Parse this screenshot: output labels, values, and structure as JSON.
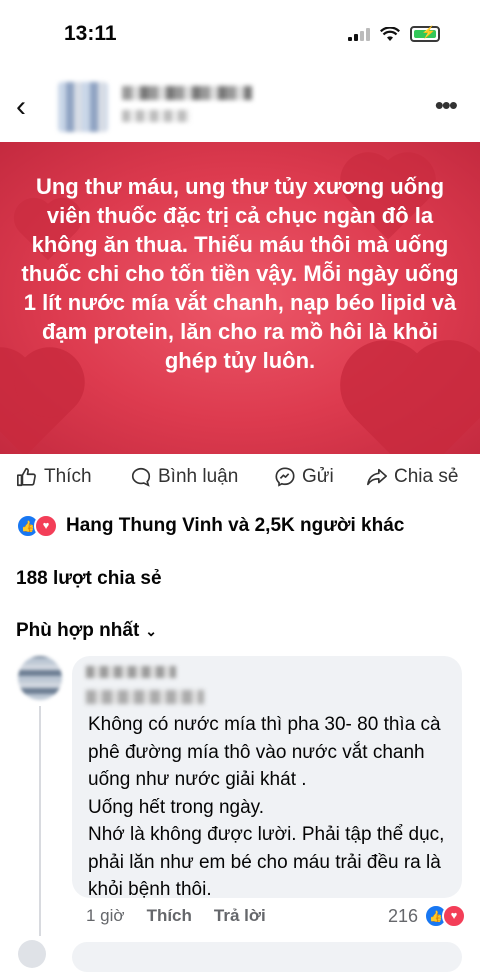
{
  "status_bar": {
    "time": "13:11"
  },
  "post": {
    "text": "Ung thư máu, ung thư tủy xương uống viên thuốc đặc trị cả chục ngàn đô la không ăn thua. Thiếu máu thôi mà uống thuốc chi cho tốn tiền vậy. Mỗi ngày uống 1 lít nước mía vắt chanh, nạp béo lipid và đạm protein, lăn cho ra mồ hôi là khỏi ghép tủy luôn."
  },
  "actions": {
    "like": "Thích",
    "comment": "Bình luận",
    "send": "Gửi",
    "share": "Chia sẻ"
  },
  "reactions_summary": "Hang Thung Vinh và 2,5K người khác",
  "shares_count": "188 lượt chia sẻ",
  "sort_label": "Phù hợp nhất",
  "comment": {
    "text": "Không có nước mía thì pha 30- 80 thìa cà phê đường mía thô vào nước vắt chanh uống như nước giải khát .\nUống hết trong ngày.\nNhớ là không được lười. Phải tập thể dục, phải lăn như em bé cho máu trải đều ra là khỏi bệnh thôi.",
    "time": "1 giờ",
    "like_label": "Thích",
    "reply_label": "Trả lời",
    "reaction_count": "216"
  },
  "colors": {
    "like_blue": "#1877f2",
    "love_red": "#f33e58",
    "image_bg": "#dd3b4f"
  }
}
